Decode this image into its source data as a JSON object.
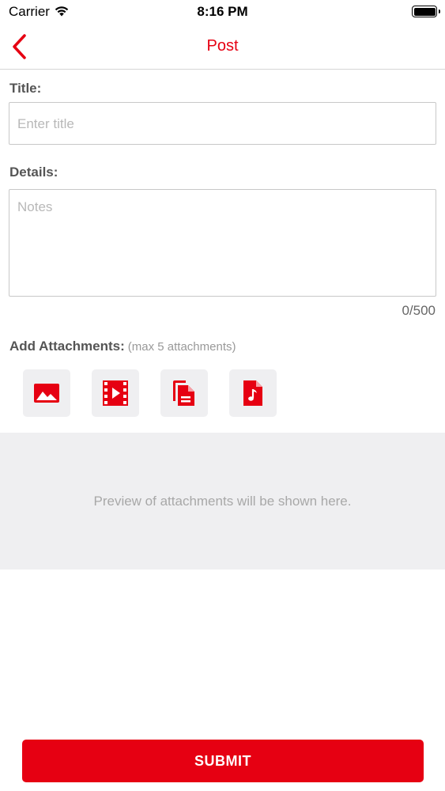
{
  "status_bar": {
    "carrier": "Carrier",
    "time": "8:16 PM"
  },
  "nav": {
    "title": "Post",
    "back_icon": "chevron-left-icon"
  },
  "form": {
    "title_label": "Title:",
    "title_placeholder": "Enter title",
    "title_value": "",
    "details_label": "Details:",
    "details_placeholder": "Notes",
    "details_value": "",
    "char_counter": "0/500"
  },
  "attachments": {
    "label": "Add Attachments:",
    "hint": "(max 5 attachments)",
    "buttons": [
      {
        "icon": "image-icon"
      },
      {
        "icon": "video-icon"
      },
      {
        "icon": "document-icon"
      },
      {
        "icon": "audio-file-icon"
      }
    ],
    "preview_text": "Preview of attachments will be shown here."
  },
  "submit_label": "SUBMIT",
  "colors": {
    "accent": "#e60012",
    "tile_bg": "#efeff1",
    "placeholder": "#b8b8b8"
  }
}
